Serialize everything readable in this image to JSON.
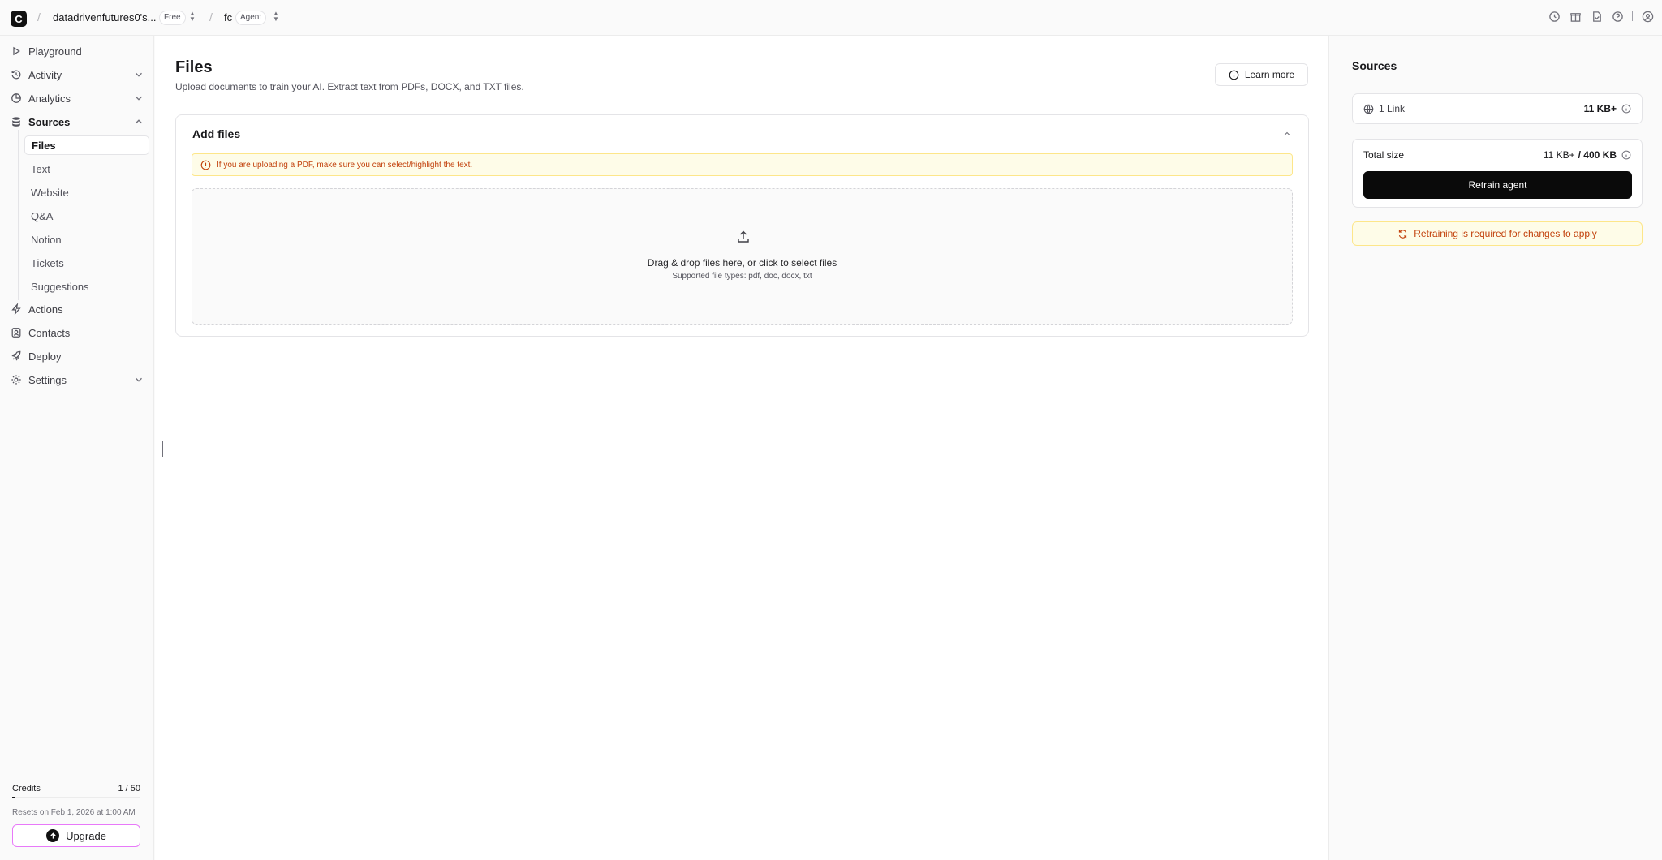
{
  "header": {
    "logo_letter": "C",
    "workspace_name": "datadrivenfutures0's...",
    "plan_badge": "Free",
    "agent_name": "fc",
    "agent_badge": "Agent",
    "separator": "/"
  },
  "sidebar": {
    "items": {
      "playground": "Playground",
      "activity": "Activity",
      "analytics": "Analytics",
      "sources": "Sources",
      "actions": "Actions",
      "contacts": "Contacts",
      "deploy": "Deploy",
      "settings": "Settings"
    },
    "sources_sub": {
      "files": "Files",
      "text": "Text",
      "website": "Website",
      "qa": "Q&A",
      "notion": "Notion",
      "tickets": "Tickets",
      "suggestions": "Suggestions"
    },
    "credits": {
      "label": "Credits",
      "value": "1 / 50",
      "used_fraction": 0.02,
      "reset_text": "Resets on Feb 1, 2026 at 1:00 AM"
    },
    "upgrade_label": "Upgrade"
  },
  "main": {
    "title": "Files",
    "subtitle": "Upload documents to train your AI. Extract text from PDFs, DOCX, and TXT files.",
    "learn_more": "Learn more",
    "card": {
      "title": "Add files",
      "warning": "If you are uploading a PDF, make sure you can select/highlight the text.",
      "drop_title": "Drag & drop files here, or click to select files",
      "drop_sub": "Supported file types: pdf, doc, docx, txt"
    }
  },
  "right_panel": {
    "title": "Sources",
    "link_label": "1 Link",
    "link_size": "11 KB+",
    "total_label": "Total size",
    "total_used": "11 KB+",
    "total_limit": "/ 400 KB",
    "retrain_label": "Retrain agent",
    "notice": "Retraining is required for changes to apply"
  },
  "colors": {
    "accent_dark": "#0a0a0a",
    "warning_text": "#c2410c",
    "warning_bg": "#fefce8",
    "upgrade_border": "#e879f9"
  }
}
